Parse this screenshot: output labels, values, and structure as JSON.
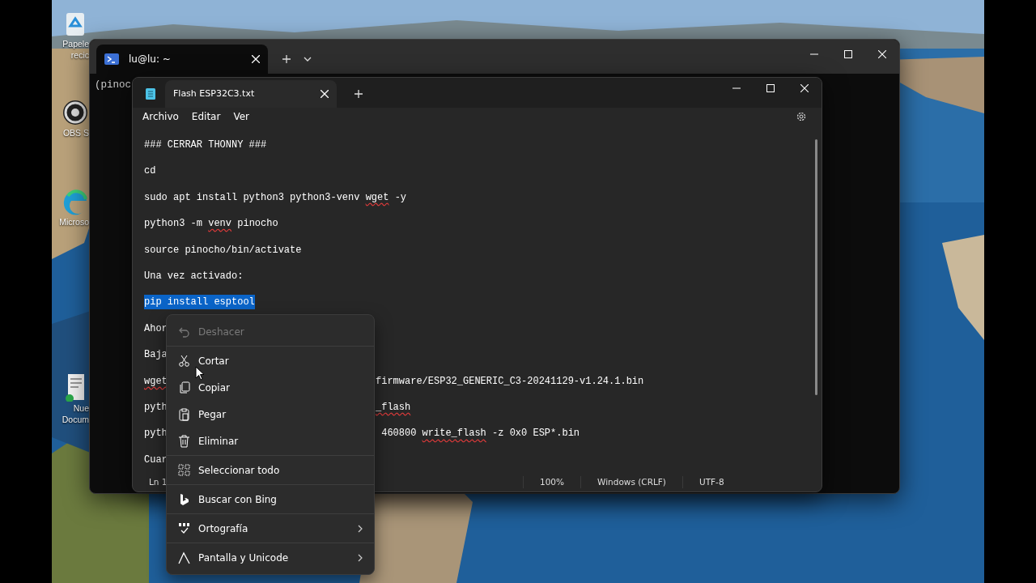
{
  "desktop": {
    "icons": [
      {
        "label_lines": [
          "Papele",
          "recic"
        ]
      },
      {
        "label_lines": [
          "OBS S"
        ]
      },
      {
        "label_lines": [
          "Microso"
        ]
      },
      {
        "label_lines": [
          "Nue",
          "Docum"
        ]
      }
    ]
  },
  "terminal": {
    "tab": {
      "title": "lu@lu: ~",
      "selected": true
    },
    "prompt": "(pinoc"
  },
  "notepad": {
    "tab": {
      "title": "Flash ESP32C3.txt",
      "selected": true
    },
    "menu": [
      "Archivo",
      "Editar",
      "Ver"
    ],
    "lines": [
      {
        "left": [
          {
            "text": "### CERRAR THONNY ###"
          }
        ]
      },
      {
        "left": [
          {
            "text": "cd"
          }
        ]
      },
      {
        "left": [
          {
            "text": "sudo apt install python3 python3-venv "
          },
          {
            "text": "wget",
            "misspelled": true
          },
          {
            "text": " -y"
          }
        ]
      },
      {
        "left": [
          {
            "text": "python3 -m "
          },
          {
            "text": "venv",
            "misspelled": true
          },
          {
            "text": " pinocho"
          }
        ]
      },
      {
        "left": [
          {
            "text": "source pinocho/bin/activate"
          }
        ]
      },
      {
        "left": [
          {
            "text": "Una vez activado:"
          }
        ]
      },
      {
        "left": [
          {
            "text": "pip install esptool"
          }
        ],
        "selected": true
      },
      {
        "left": [
          {
            "text": "Ahor"
          }
        ]
      },
      {
        "left": [
          {
            "text": "Baja"
          }
        ]
      },
      {
        "left": [
          {
            "text": "wget",
            "misspelled": true
          }
        ],
        "right": [
          {
            "text": "firmware/ESP32_GENERIC_C3-20241129-v1.24.1.bin"
          }
        ]
      },
      {
        "left": [
          {
            "text": "pyth"
          }
        ],
        "right": [
          {
            "text": "_flash",
            "misspelled": true
          }
        ]
      },
      {
        "left": [
          {
            "text": "pyth"
          }
        ],
        "right": [
          {
            "text": " 460800 "
          },
          {
            "text": "write_flash",
            "misspelled": true
          },
          {
            "text": " -z 0x0 ESP*.bin"
          }
        ]
      },
      {
        "left": [
          {
            "text": "Cuar"
          }
        ]
      }
    ],
    "status_bar": [
      "Ln 1",
      "100%",
      "Windows (CRLF)",
      "UTF-8"
    ]
  },
  "context_menu": {
    "groups": [
      [
        {
          "label": "Deshacer",
          "disabled": true
        }
      ],
      [
        {
          "label": "Cortar",
          "disabled": false
        },
        {
          "label": "Copiar",
          "disabled": false
        },
        {
          "label": "Pegar",
          "disabled": false
        },
        {
          "label": "Eliminar",
          "disabled": false
        }
      ],
      [
        {
          "label": "Seleccionar todo",
          "disabled": false
        }
      ],
      [
        {
          "label": "Buscar con Bing",
          "disabled": false
        }
      ],
      [
        {
          "label": "Ortografía",
          "disabled": false,
          "submenu": true
        }
      ],
      [
        {
          "label": "Pantalla y Unicode",
          "disabled": false,
          "submenu": true
        }
      ]
    ]
  }
}
